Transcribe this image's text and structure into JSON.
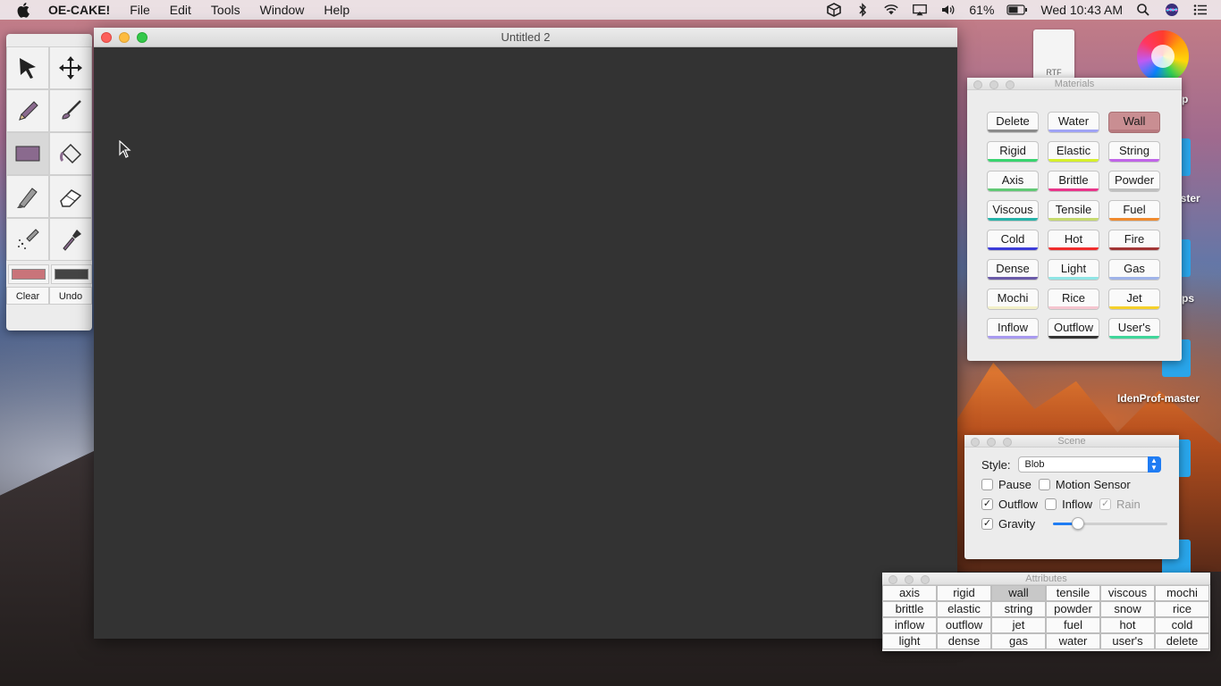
{
  "menubar": {
    "app_name": "OE-CAKE!",
    "items": [
      "File",
      "Edit",
      "Tools",
      "Window",
      "Help"
    ],
    "battery": "61%",
    "clock": "Wed 10:43 AM",
    "status_icons": [
      "dropbox-icon",
      "bluetooth-icon",
      "wifi-icon",
      "airplay-icon",
      "volume-icon",
      "battery-icon",
      "search-icon",
      "siri-icon",
      "notification-list-icon"
    ]
  },
  "desktop": {
    "file_label": "RTF",
    "labels": [
      "p",
      "aster",
      "ps",
      "IdenProf-master"
    ]
  },
  "tools": {
    "items": [
      "pointer-icon",
      "move-icon",
      "pencil-icon",
      "brush-icon",
      "rectangle-icon",
      "fill-bucket-icon",
      "knife-icon",
      "eraser-icon",
      "spray-icon",
      "dropper-icon"
    ],
    "selected": "rectangle-icon",
    "color_primary": "#c9747a",
    "color_secondary": "#444444",
    "clear_label": "Clear",
    "undo_label": "Undo"
  },
  "window": {
    "title": "Untitled 2",
    "canvas_color": "#333333"
  },
  "materials": {
    "title": "Materials",
    "buttons": [
      {
        "label": "Delete",
        "color": "#8a8a8a"
      },
      {
        "label": "Water",
        "color": "#9fa3f5"
      },
      {
        "label": "Wall",
        "color": "#b87a7f",
        "active": true
      },
      {
        "label": "Rigid",
        "color": "#39d46f"
      },
      {
        "label": "Elastic",
        "color": "#d6f02b"
      },
      {
        "label": "String",
        "color": "#c064e8"
      },
      {
        "label": "Axis",
        "color": "#61c975"
      },
      {
        "label": "Brittle",
        "color": "#e8358a"
      },
      {
        "label": "Powder",
        "color": "#bfbfbf"
      },
      {
        "label": "Viscous",
        "color": "#25b3a9"
      },
      {
        "label": "Tensile",
        "color": "#c5d96e"
      },
      {
        "label": "Fuel",
        "color": "#ef8a2e"
      },
      {
        "label": "Cold",
        "color": "#3b3bd8"
      },
      {
        "label": "Hot",
        "color": "#ef2c2c"
      },
      {
        "label": "Fire",
        "color": "#a23636"
      },
      {
        "label": "Dense",
        "color": "#6a5aa8"
      },
      {
        "label": "Light",
        "color": "#8fe5e5"
      },
      {
        "label": "Gas",
        "color": "#9fb3e8"
      },
      {
        "label": "Mochi",
        "color": "#f3f0c9"
      },
      {
        "label": "Rice",
        "color": "#f5c5cf"
      },
      {
        "label": "Jet",
        "color": "#f5d02a"
      },
      {
        "label": "Inflow",
        "color": "#a89af0"
      },
      {
        "label": "Outflow",
        "color": "#333333"
      },
      {
        "label": "User's",
        "color": "#3fd69a"
      }
    ]
  },
  "scene": {
    "title": "Scene",
    "style_label": "Style:",
    "style_value": "Blob",
    "checkboxes": [
      {
        "label": "Pause",
        "checked": false
      },
      {
        "label": "Motion Sensor",
        "checked": false
      },
      {
        "label": "Outflow",
        "checked": true
      },
      {
        "label": "Inflow",
        "checked": false
      },
      {
        "label": "Rain",
        "checked": true,
        "disabled": true
      },
      {
        "label": "Gravity",
        "checked": true
      }
    ],
    "gravity_level": 0.22
  },
  "attributes": {
    "title": "Attributes",
    "cells": [
      "axis",
      "rigid",
      "wall",
      "tensile",
      "viscous",
      "mochi",
      "brittle",
      "elastic",
      "string",
      "powder",
      "snow",
      "rice",
      "inflow",
      "outflow",
      "jet",
      "fuel",
      "hot",
      "cold",
      "light",
      "dense",
      "gas",
      "water",
      "user's",
      "delete"
    ],
    "selected": "wall"
  }
}
